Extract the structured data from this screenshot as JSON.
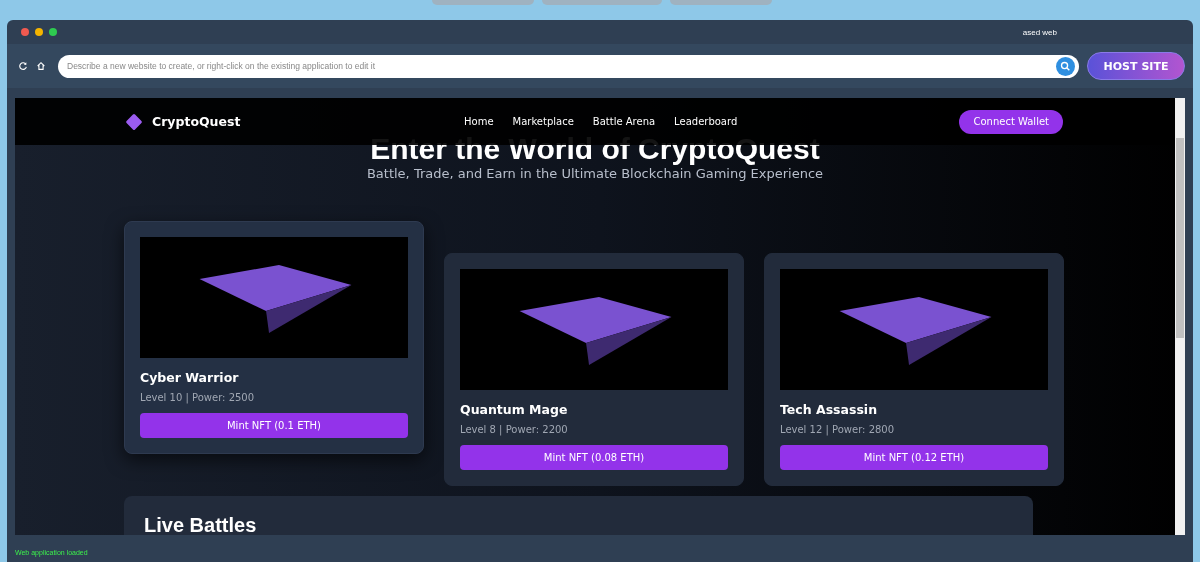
{
  "window": {
    "title": "ased web"
  },
  "toolbar": {
    "prompt_placeholder": "Describe a new website to create, or right-click on the existing application to edit it",
    "host_button": "HOST SITE"
  },
  "site": {
    "brand": "CryptoQuest",
    "nav": [
      {
        "label": "Home"
      },
      {
        "label": "Marketplace"
      },
      {
        "label": "Battle Arena"
      },
      {
        "label": "Leaderboard"
      }
    ],
    "wallet_button": "Connect Wallet",
    "hero_title": "Enter the World of CryptoQuest",
    "hero_subtitle": "Battle, Trade, and Earn in the Ultimate Blockchain Gaming Experience",
    "cards": [
      {
        "name": "Cyber Warrior",
        "stats": "Level 10 | Power: 2500",
        "button": "Mint NFT (0.1 ETH)",
        "raised": true
      },
      {
        "name": "Quantum Mage",
        "stats": "Level 8 | Power: 2200",
        "button": "Mint NFT (0.08 ETH)",
        "raised": false
      },
      {
        "name": "Tech Assassin",
        "stats": "Level 12 | Power: 2800",
        "button": "Mint NFT (0.12 ETH)",
        "raised": false
      }
    ],
    "section_title": "Live Battles"
  },
  "status_bar": "Web application loaded"
}
